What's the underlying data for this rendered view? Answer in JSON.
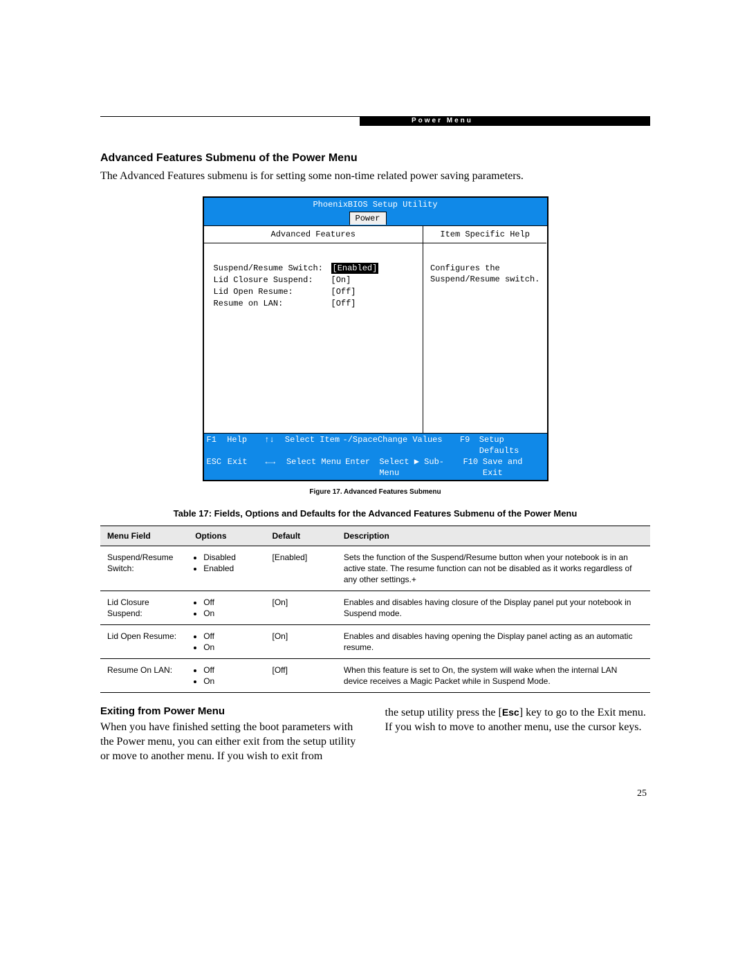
{
  "header": {
    "section": "Power Menu"
  },
  "section1": {
    "title": "Advanced Features Submenu of the Power Menu",
    "intro": "The Advanced Features submenu is for setting some non-time related power saving parameters."
  },
  "bios": {
    "title": "PhoenixBIOS Setup Utility",
    "tab": "Power",
    "left_header": "Advanced Features",
    "right_header": "Item Specific Help",
    "items": [
      {
        "label": "Suspend/Resume Switch:",
        "value": "[Enabled]",
        "selected": true
      },
      {
        "label": "Lid Closure Suspend:",
        "value": "[On]",
        "selected": false
      },
      {
        "label": "Lid Open Resume:",
        "value": "[Off]",
        "selected": false
      },
      {
        "label": "Resume on LAN:",
        "value": "[Off]",
        "selected": false
      }
    ],
    "help_text": "Configures the Suspend/Resume switch.",
    "footer": {
      "r1": {
        "k1": "F1",
        "t1": "Help",
        "k2": "↑↓",
        "t2": "Select Item",
        "k3": "-/Space",
        "t3": "Change Values",
        "k4": "F9",
        "t4": "Setup Defaults"
      },
      "r2": {
        "k1": "ESC",
        "t1": "Exit",
        "k2": "←→",
        "t2": "Select Menu",
        "k3": "Enter",
        "t3": "Select ▶ Sub-Menu",
        "k4": "F10",
        "t4": "Save and Exit"
      }
    }
  },
  "figure_caption": "Figure 17.  Advanced Features Submenu",
  "table_caption": "Table 17: Fields, Options and Defaults for the Advanced Features Submenu of the Power Menu",
  "table": {
    "headers": {
      "c1": "Menu Field",
      "c2": "Options",
      "c3": "Default",
      "c4": "Description"
    },
    "rows": [
      {
        "field": "Suspend/Resume Switch:",
        "options": [
          "Disabled",
          "Enabled"
        ],
        "default": "[Enabled]",
        "desc": "Sets the function of the Suspend/Resume button when your notebook is in an active state. The resume function can not be disabled as it works regardless of any other settings.+"
      },
      {
        "field": "Lid Closure Suspend:",
        "options": [
          "Off",
          "On"
        ],
        "default": "[On]",
        "desc": "Enables and disables having closure of the Display panel put your notebook in Suspend mode."
      },
      {
        "field": "Lid Open Resume:",
        "options": [
          "Off",
          "On"
        ],
        "default": "[On]",
        "desc": "Enables and disables having opening the Display panel acting as an automatic resume."
      },
      {
        "field": "Resume On LAN:",
        "options": [
          "Off",
          "On"
        ],
        "default": "[Off]",
        "desc": "When this feature is set to On, the system will wake when the internal LAN device receives a Magic Packet while in Suspend Mode."
      }
    ]
  },
  "exit_section": {
    "title": "Exiting from Power Menu",
    "left": "When you have finished setting the boot parameters with the Power menu, you can either exit from the setup utility or move to another menu. If you wish to exit from",
    "right_a": "the setup utility press the [",
    "right_key": "Esc",
    "right_b": "] key to go to the Exit menu. If you wish to move to another menu, use the cursor keys."
  },
  "page_number": "25"
}
